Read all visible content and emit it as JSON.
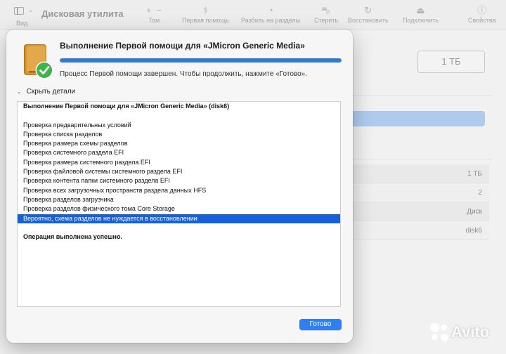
{
  "app": {
    "title": "Дисковая утилита",
    "view_label": "Вид"
  },
  "toolbar": {
    "items": [
      {
        "label": "Том",
        "icon": "plus-minus-icon"
      },
      {
        "label": "Первая помощь",
        "icon": "stethoscope-icon"
      },
      {
        "label": "Разбить на разделы",
        "icon": "pie-chart-icon"
      },
      {
        "label": "Стереть",
        "icon": "car-erase-icon"
      },
      {
        "label": "Восстановить",
        "icon": "restore-icon"
      },
      {
        "label": "Подключить",
        "icon": "eject-icon"
      },
      {
        "label": "Свойства",
        "icon": "info-icon"
      }
    ]
  },
  "background": {
    "size_display": "1 ТБ",
    "info_rows": [
      "1 ТБ",
      "2",
      "Диск",
      "disk6"
    ]
  },
  "dialog": {
    "title": "Выполнение Первой помощи для «JMicron Generic Media»",
    "progress": 1.0,
    "status": "Процесс Первой помощи завершен. Чтобы продолжить, нажмите «Готово».",
    "details_toggle": "Скрыть детали",
    "log": [
      {
        "text": "Выполнение Первой помощи для «JMicron Generic Media» (disk6)",
        "style": "bold"
      },
      {
        "text": "",
        "style": "normal"
      },
      {
        "text": "Проверка предварительных условий",
        "style": "normal"
      },
      {
        "text": "Проверка списка разделов",
        "style": "normal"
      },
      {
        "text": "Проверка размера схемы разделов",
        "style": "normal"
      },
      {
        "text": "Проверка системного раздела EFI",
        "style": "normal"
      },
      {
        "text": "Проверка размера системного раздела EFI",
        "style": "normal"
      },
      {
        "text": "Проверка файловой системы системного раздела EFI",
        "style": "normal"
      },
      {
        "text": "Проверка контента папки системного раздела EFI",
        "style": "normal"
      },
      {
        "text": "Проверка всех загрузочных пространств раздела данных HFS",
        "style": "normal"
      },
      {
        "text": "Проверка разделов загрузчика",
        "style": "normal"
      },
      {
        "text": "Проверка разделов физического тома Core Storage",
        "style": "normal"
      },
      {
        "text": "Вероятно, схема разделов не нуждается в восстановлении",
        "style": "selected"
      },
      {
        "text": "",
        "style": "normal"
      },
      {
        "text": "Операция выполнена успешно.",
        "style": "bold"
      }
    ],
    "done_button": "Готово"
  },
  "watermark": {
    "text": "Avito"
  },
  "colors": {
    "accent": "#2f7ff0",
    "selection": "#1660d8",
    "progress": "#2f79d9",
    "disk_icon": "#c8862a",
    "checkmark": "#3cb44a"
  }
}
